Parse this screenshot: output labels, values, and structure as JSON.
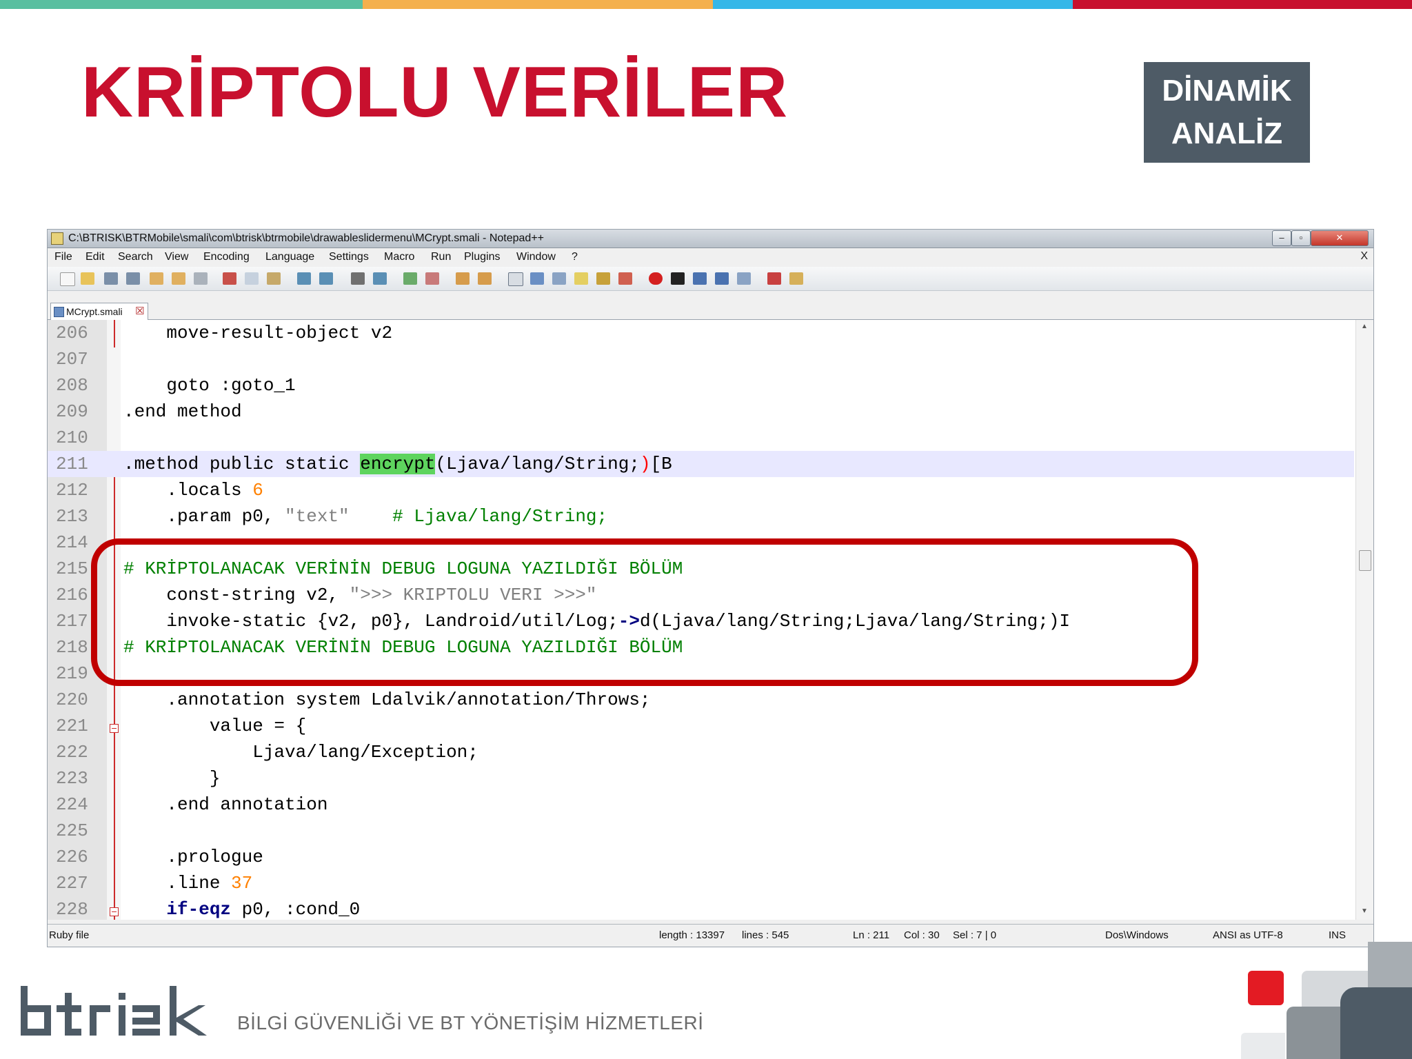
{
  "colors": {
    "top_bar": [
      "#59bfa0",
      "#f4b04d",
      "#35b7e8",
      "#c8102e"
    ],
    "title": "#c8102e",
    "badge_bg": "#4e5b66",
    "highlight_box": "#c00000",
    "brand_red": "#e31b23"
  },
  "slide": {
    "title": "KRİPTOLU VERİLER",
    "badge_line1": "DİNAMİK",
    "badge_line2": "ANALİZ"
  },
  "window": {
    "title": "C:\\BTRISK\\BTRMobile\\smali\\com\\btrisk\\btrmobile\\drawableslidermenu\\MCrypt.smali - Notepad++",
    "menu": [
      "File",
      "Edit",
      "Search",
      "View",
      "Encoding",
      "Language",
      "Settings",
      "Macro",
      "Run",
      "Plugins",
      "Window",
      "?"
    ],
    "menu_close": "X",
    "tab_label": "MCrypt.smali",
    "tab_close": "☒",
    "btn_min": "–",
    "btn_max": "▫",
    "btn_close": "✕"
  },
  "editor": {
    "line_numbers": [
      "206",
      "207",
      "208",
      "209",
      "210",
      "211",
      "212",
      "213",
      "214",
      "215",
      "216",
      "217",
      "218",
      "219",
      "220",
      "221",
      "222",
      "223",
      "224",
      "225",
      "226",
      "227",
      "228"
    ],
    "l206": "    move-result-object v2",
    "l208": "    goto :goto_1",
    "l209": ".end method",
    "l211_a": ".method public static ",
    "l211_b": "encrypt",
    "l211_c": "(Ljava/lang/String;",
    "l211_d": ")",
    "l211_e": "[B",
    "l212_a": "    .locals ",
    "l212_b": "6",
    "l213_a": "    .param p0, ",
    "l213_b": "\"text\"",
    "l213_c": "    # Ljava/lang/String;",
    "l215": "# KRİPTOLANACAK VERİNİN DEBUG LOGUNA YAZILDIĞI BÖLÜM",
    "l216_a": "    const-string v2, ",
    "l216_b": "\">>> KRIPTOLU VERI >>>\"",
    "l217_a": "    invoke-static {v2, p0}, Landroid/util/Log;",
    "l217_b": "->",
    "l217_c": "d(Ljava/lang/String;Ljava/lang/String;)I",
    "l218": "# KRİPTOLANACAK VERİNİN DEBUG LOGUNA YAZILDIĞI BÖLÜM",
    "l220": "    .annotation system Ldalvik/annotation/Throws;",
    "l221": "        value = {",
    "l222": "            Ljava/lang/Exception;",
    "l223": "        }",
    "l224": "    .end annotation",
    "l226": "    .prologue",
    "l227_a": "    .line ",
    "l227_b": "37",
    "l228_a": "    ",
    "l228_b": "if-eqz",
    "l228_c": " p0, :cond_0"
  },
  "status": {
    "filetype": "Ruby file",
    "length": "length : 13397",
    "lines": "lines : 545",
    "ln": "Ln : 211",
    "col": "Col : 30",
    "sel": "Sel : 7 | 0",
    "eol": "Dos\\Windows",
    "encoding": "ANSI as UTF-8",
    "mode": "INS"
  },
  "footer": {
    "tagline": "BİLGİ GÜVENLİĞİ VE BT YÖNETİŞİM HİZMETLERİ"
  }
}
